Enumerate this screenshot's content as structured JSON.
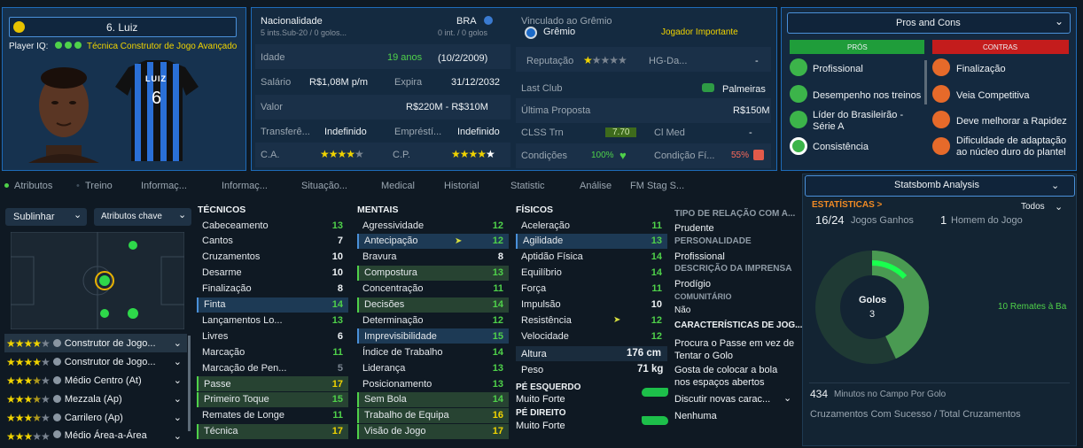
{
  "player": {
    "name": "6. Luiz",
    "iq_label": "Player IQ:",
    "iq_roles": "Técnica  Construtor de Jogo Avançado",
    "shirt_name": "LUIZ",
    "shirt_number": "6"
  },
  "info": {
    "nationality_label": "Nacionalidade",
    "nationality_value": "BRA",
    "nationality_sub": "5 ints.Sub-20 / 0 golos...",
    "nationality_sub2": "0 int. / 0 golos",
    "age_label": "Idade",
    "age_value": "19 anos",
    "age_date": "(10/2/2009)",
    "salary_label": "Salário",
    "salary_value": "R$1,08M p/m",
    "expires_label": "Expira",
    "expires_value": "31/12/2032",
    "value_label": "Valor",
    "value_value": "R$220M - R$310M",
    "transfer_label": "Transferê...",
    "transfer_value": "Indefinido",
    "loan_label": "Empréstí...",
    "loan_value": "Indefinido",
    "ca_label": "C.A.",
    "cp_label": "C.P."
  },
  "club": {
    "linked_label": "Vinculado ao Grêmio",
    "club_name": "Grêmio",
    "status": "Jogador Importante",
    "reputation_label": "Reputação",
    "hg_label": "HG-Da...",
    "hg_value": "-",
    "last_club_label": "Last Club",
    "last_club_value": "Palmeiras",
    "last_offer_label": "Última Proposta",
    "last_offer_value": "R$150M",
    "clss_label": "CLSS Trn",
    "clss_value": "7.70",
    "clmed_label": "Cl Med",
    "clmed_value": "-",
    "conditions_label": "Condições",
    "conditions_value": "100%",
    "match_cond_label": "Condição Fí...",
    "match_cond_value": "55%"
  },
  "pros_cons": {
    "dropdown_label": "Pros and Cons",
    "pros_title": "PRÓS",
    "cons_title": "CONTRAS",
    "pros": [
      "Profissional",
      "Desempenho nos treinos",
      "Líder do Brasileirão - Série A",
      "Consistência"
    ],
    "cons": [
      "Finalização",
      "Veia Competitiva",
      "Deve melhorar a Rapidez",
      "Dificuldade de adaptação ao núcleo duro do plantel"
    ]
  },
  "tabs": [
    "Atributos",
    "Treino",
    "Informaç...",
    "Informaç...",
    "Situação...",
    "Medical",
    "Historial",
    "Statistic",
    "Análise",
    "FM Stag S..."
  ],
  "left": {
    "view_dropdown": "Sublinhar",
    "filter_dropdown": "Atributos chave",
    "roles": [
      {
        "name": "Construtor de Jogo...",
        "stars": 4,
        "half": false
      },
      {
        "name": "Construtor de Jogo...",
        "stars": 4,
        "half": false
      },
      {
        "name": "Médio Centro (At)",
        "stars": 3,
        "half": true
      },
      {
        "name": "Mezzala (Ap)",
        "stars": 3,
        "half": true
      },
      {
        "name": "Carrilero (Ap)",
        "stars": 3,
        "half": true
      },
      {
        "name": "Médio Área-a-Área",
        "stars": 3,
        "half": false
      }
    ]
  },
  "tecnicos": {
    "title": "TÉCNICOS",
    "rows": [
      {
        "n": "Cabeceamento",
        "v": "13",
        "c": "g",
        "h": ""
      },
      {
        "n": "Cantos",
        "v": "7",
        "c": "",
        "h": ""
      },
      {
        "n": "Cruzamentos",
        "v": "10",
        "c": "",
        "h": ""
      },
      {
        "n": "Desarme",
        "v": "10",
        "c": "",
        "h": ""
      },
      {
        "n": "Finalização",
        "v": "8",
        "c": "",
        "h": ""
      },
      {
        "n": "Finta",
        "v": "14",
        "c": "g",
        "h": "hl"
      },
      {
        "n": "Lançamentos Lo...",
        "v": "13",
        "c": "g",
        "h": ""
      },
      {
        "n": "Livres",
        "v": "6",
        "c": "",
        "h": ""
      },
      {
        "n": "Marcação",
        "v": "11",
        "c": "g",
        "h": ""
      },
      {
        "n": "Marcação de Pen...",
        "v": "5",
        "c": "gr",
        "h": ""
      },
      {
        "n": "Passe",
        "v": "17",
        "c": "y",
        "h": "hlg"
      },
      {
        "n": "Primeiro Toque",
        "v": "15",
        "c": "g",
        "h": "hlg"
      },
      {
        "n": "Remates de Longe",
        "v": "11",
        "c": "g",
        "h": ""
      },
      {
        "n": "Técnica",
        "v": "17",
        "c": "y",
        "h": "hlg"
      }
    ]
  },
  "mentais": {
    "title": "MENTAIS",
    "rows": [
      {
        "n": "Agressividade",
        "v": "12",
        "c": "g",
        "h": ""
      },
      {
        "n": "Antecipação",
        "v": "12",
        "c": "g",
        "h": "hl"
      },
      {
        "n": "Bravura",
        "v": "8",
        "c": "",
        "h": ""
      },
      {
        "n": "Compostura",
        "v": "13",
        "c": "g",
        "h": "hlg"
      },
      {
        "n": "Concentração",
        "v": "11",
        "c": "g",
        "h": ""
      },
      {
        "n": "Decisões",
        "v": "14",
        "c": "g",
        "h": "hlg"
      },
      {
        "n": "Determinação",
        "v": "12",
        "c": "g",
        "h": ""
      },
      {
        "n": "Imprevisibilidade",
        "v": "15",
        "c": "g",
        "h": "hl"
      },
      {
        "n": "Índice de Trabalho",
        "v": "14",
        "c": "g",
        "h": ""
      },
      {
        "n": "Liderança",
        "v": "13",
        "c": "g",
        "h": ""
      },
      {
        "n": "Posicionamento",
        "v": "13",
        "c": "g",
        "h": ""
      },
      {
        "n": "Sem Bola",
        "v": "14",
        "c": "g",
        "h": "hlg"
      },
      {
        "n": "Trabalho de Equipa",
        "v": "16",
        "c": "y",
        "h": "hlg"
      },
      {
        "n": "Visão de Jogo",
        "v": "17",
        "c": "y",
        "h": "hlg"
      }
    ]
  },
  "fisicos": {
    "title": "FÍSICOS",
    "rows": [
      {
        "n": "Aceleração",
        "v": "11",
        "c": "g",
        "h": ""
      },
      {
        "n": "Agilidade",
        "v": "13",
        "c": "g",
        "h": "hl"
      },
      {
        "n": "Aptidão Física",
        "v": "14",
        "c": "g",
        "h": ""
      },
      {
        "n": "Equilíbrio",
        "v": "14",
        "c": "g",
        "h": ""
      },
      {
        "n": "Força",
        "v": "11",
        "c": "g",
        "h": ""
      },
      {
        "n": "Impulsão",
        "v": "10",
        "c": "",
        "h": ""
      },
      {
        "n": "Resistência",
        "v": "12",
        "c": "g",
        "h": ""
      },
      {
        "n": "Velocidade",
        "v": "12",
        "c": "g",
        "h": ""
      }
    ],
    "height_label": "Altura",
    "height_value": "176 cm",
    "weight_label": "Peso",
    "weight_value": "71 kg",
    "left_foot_label": "PÉ ESQUERDO",
    "left_foot_value": "Muito Forte",
    "right_foot_label": "PÉ DIREITO",
    "right_foot_value": "Muito Forte"
  },
  "personality": {
    "rel_title": "TIPO DE RELAÇÃO COM A...",
    "rel_value": "Prudente",
    "pers_title": "PERSONALIDADE",
    "pers_value": "Profissional",
    "press_title": "DESCRIÇÃO DA IMPRENSA",
    "press_value": "Prodígio",
    "comm_title": "COMUNITÁRIO",
    "comm_value": "Não",
    "traits_title": "CARACTERÍSTICAS DE JOG...",
    "traits": [
      "Procura o Passe em vez de Tentar o Golo",
      "Gosta de colocar a bola nos espaços abertos",
      "Discutir novas carac...",
      "Nenhuma"
    ]
  },
  "statsbomb": {
    "dropdown_label": "Statsbomb Analysis",
    "section": "ESTATÍSTICAS >",
    "filter": "Todos",
    "games_won": "16/24",
    "games_won_label": "Jogos Ganhos",
    "motm": "1",
    "motm_label": "Homem do Jogo",
    "donut_label": "Golos",
    "donut_value": "3",
    "side_note": "10  Remates à Ba",
    "minutes_value": "434",
    "minutes_label": "Minutos no Campo Por Golo",
    "cross_label": "Cruzamentos Com Sucesso / Total Cruzamentos"
  }
}
